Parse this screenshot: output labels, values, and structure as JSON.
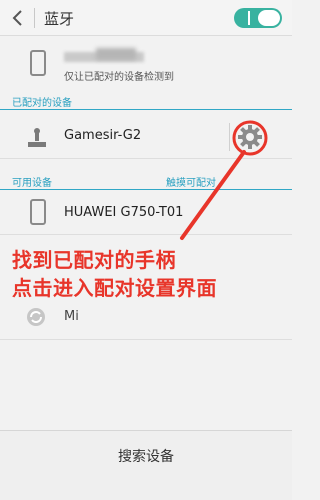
{
  "header": {
    "title": "蓝牙",
    "bluetooth_enabled": true
  },
  "this_device": {
    "subtitle": "仅让已配对的设备检测到"
  },
  "paired_section": {
    "label": "已配对的设备"
  },
  "paired_devices": [
    {
      "name": "Gamesir-G2",
      "icon": "gamepad-icon"
    }
  ],
  "available_section": {
    "label": "可用设备",
    "right_label": "触摸可配对"
  },
  "available_devices": [
    {
      "name": "HUAWEI G750-T01",
      "icon": "phone-icon"
    },
    {
      "name": "Mi",
      "icon": "refresh-icon"
    }
  ],
  "annotation": {
    "line1": "找到已配对的手柄",
    "line2": "点击进入配对设置界面",
    "color": "#e8352a"
  },
  "footer": {
    "search_label": "搜索设备"
  },
  "colors": {
    "accent": "#31a7c6",
    "toggle": "#38b2a0"
  }
}
